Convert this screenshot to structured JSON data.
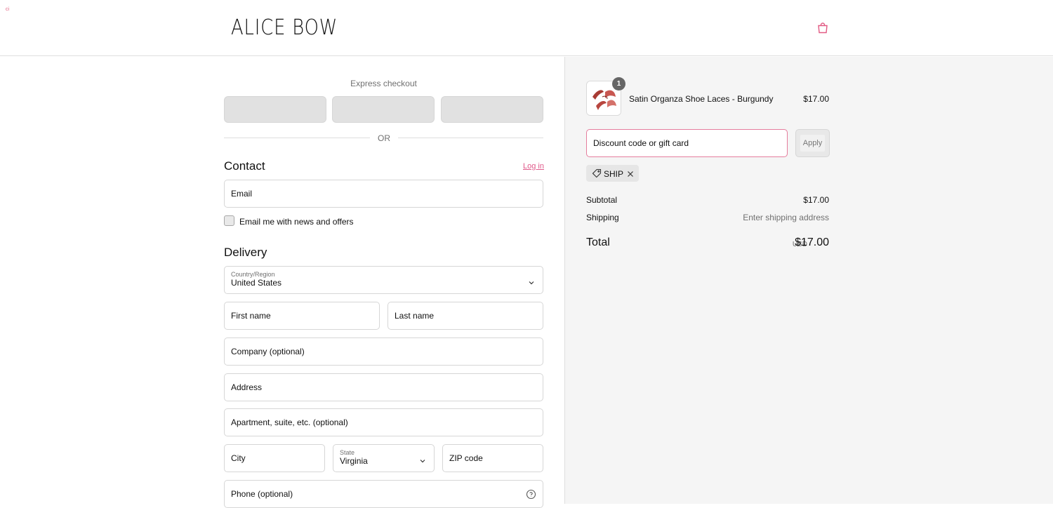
{
  "header": {
    "corner_mark": "ci",
    "logo": "ALICE BOW",
    "cart_icon": "shopping-bag-icon"
  },
  "express": {
    "title": "Express checkout",
    "divider": "OR"
  },
  "contact": {
    "title": "Contact",
    "login": "Log in",
    "email_placeholder": "Email",
    "news_label": "Email me with news and offers"
  },
  "delivery": {
    "title": "Delivery",
    "country_label": "Country/Region",
    "country_value": "United States",
    "first_name": "First name",
    "last_name": "Last name",
    "company": "Company (optional)",
    "address": "Address",
    "apartment": "Apartment, suite, etc. (optional)",
    "city": "City",
    "state_label": "State",
    "state_value": "Virginia",
    "zip": "ZIP code",
    "phone": "Phone (optional)"
  },
  "order": {
    "item_quantity": "1",
    "item_name": "Satin Organza Shoe Laces - Burgundy",
    "item_price": "$17.00",
    "discount_placeholder": "Discount code or gift card",
    "apply_label": "Apply",
    "discount_tag": "SHIP",
    "subtotal_label": "Subtotal",
    "subtotal_value": "$17.00",
    "shipping_label": "Shipping",
    "shipping_value": "Enter shipping address",
    "total_label": "Total",
    "currency": "USD",
    "total_value": "$17.00"
  },
  "colors": {
    "accent": "#e25b84",
    "panel": "#f5f5f5",
    "border": "#d6d6d6",
    "muted_text": "#707070"
  }
}
